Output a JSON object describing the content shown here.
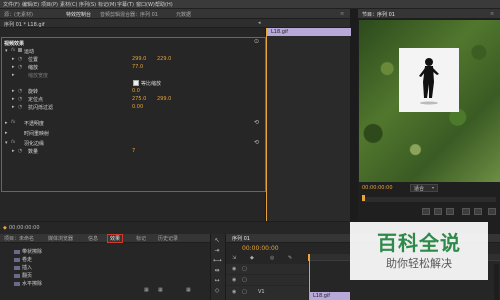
{
  "menu": [
    "文件(F)",
    "编辑(E)",
    "项目(P)",
    "素材(C)",
    "序列(S)",
    "标记(M)",
    "字幕(T)",
    "窗口(W)",
    "帮助(H)"
  ],
  "source_tabs": {
    "source": "源：(无素材)",
    "effect_controls": "特效控制台",
    "audio_mixer": "音频剪辑混合器：序列 01",
    "metadata": "元数据"
  },
  "effect_controls": {
    "sequence_clip": "序列 01 * L18.gif",
    "clip_label": "L18.gif",
    "section_video": "视频效果",
    "motion": "运动",
    "position_label": "位置",
    "position_x": "299.0",
    "position_y": "229.0",
    "scale_label": "缩放",
    "scale_value": "77.0",
    "scale_width_label": "缩放宽度",
    "uniform_scale_label": "等比缩放",
    "rotation_label": "旋转",
    "rotation_value": "0.0",
    "anchor_label": "定位点",
    "anchor_x": "275.0",
    "anchor_y": "299.0",
    "antiflicker_label": "抗闪烁过滤",
    "antiflicker_value": "0.00",
    "opacity_label": "不透明度",
    "time_remap_label": "时间重映射",
    "effect_name": "羽化边缘",
    "amount_label": "数量",
    "amount_value": "7",
    "timecode": "00:00:00:00"
  },
  "program_monitor": {
    "title": "节目：序列 01",
    "timecode": "00:00:00:00",
    "fit": "适合"
  },
  "project_tabs": {
    "project": "项目：未命名",
    "media_browser": "媒体浏览器",
    "info": "信息",
    "effects": "效果",
    "markers": "标记",
    "history": "历史记录"
  },
  "effects_list": [
    "带状擦除",
    "卷走",
    "插入",
    "翻页",
    "水平擦除"
  ],
  "timeline": {
    "tab": "序列 01",
    "timecode": "00:00:00:00",
    "track_v1": "V1",
    "clip": "L18.gif"
  },
  "watermark": {
    "title": "百科全说",
    "subtitle": "助你轻松解决"
  },
  "colors": {
    "accent_red": "#d23a2c",
    "value_orange": "#e8a33a",
    "clip_purple": "#b7a9d9",
    "playhead_orange": "#e8a33a"
  }
}
